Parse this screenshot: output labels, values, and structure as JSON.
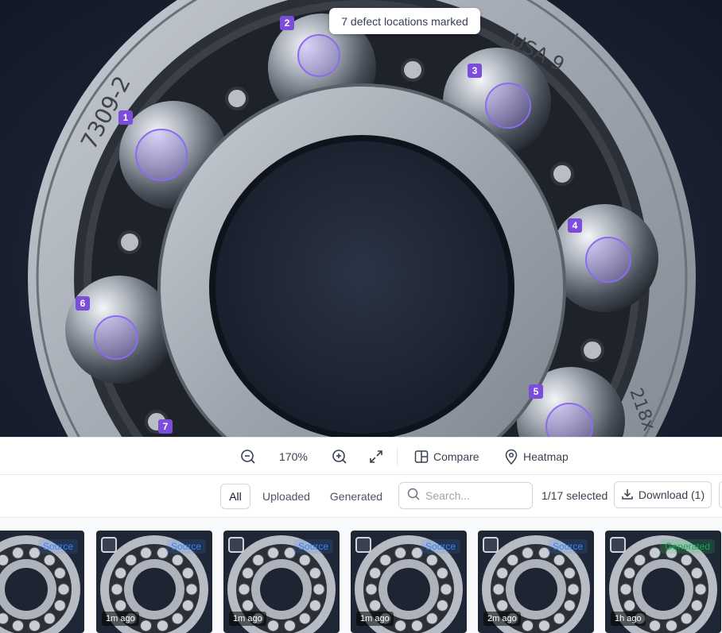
{
  "viewer": {
    "notice": "7 defect locations marked",
    "bearing_markings": {
      "left": "7309-2",
      "top_right": "USA 9",
      "bottom_right": "218x"
    },
    "markers": [
      "1",
      "2",
      "3",
      "4",
      "5",
      "6",
      "7"
    ],
    "marker_color": "#7c4ddb"
  },
  "toolbar": {
    "zoom_out_icon": "zoom-out-icon",
    "zoom_level": "170%",
    "zoom_in_icon": "zoom-in-icon",
    "fullscreen_icon": "expand-icon",
    "compare_label": "Compare",
    "heatmap_label": "Heatmap"
  },
  "filters": {
    "tabs": [
      "All",
      "Uploaded",
      "Generated"
    ],
    "active": "All",
    "search_placeholder": "Search...",
    "selected_count": "1/17 selected",
    "download_label": "Download (1)"
  },
  "gallery": {
    "items": [
      {
        "tag": "Source",
        "time": "go"
      },
      {
        "tag": "Source",
        "time": "1m ago"
      },
      {
        "tag": "Source",
        "time": "1m ago"
      },
      {
        "tag": "Source",
        "time": "1m ago"
      },
      {
        "tag": "Source",
        "time": "2m ago"
      },
      {
        "tag": "Generated",
        "time": "1h ago"
      }
    ],
    "colors": {
      "source": "#3b82f6",
      "generated": "#16a34a"
    }
  }
}
